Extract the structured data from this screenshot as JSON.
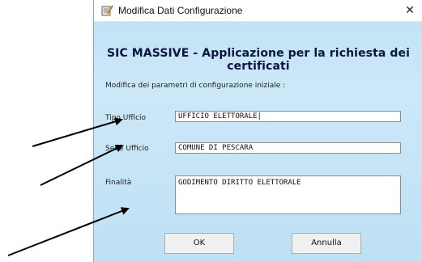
{
  "window": {
    "title": "Modifica Dati Configurazione",
    "close_label": "✕",
    "icon": "notepad-pen-icon"
  },
  "heading": "SIC MASSIVE - Applicazione per la richiesta dei certificati",
  "intro": "Modifica dei parametri di configurazione iniziale :",
  "fields": {
    "tipo_ufficio": {
      "label": "Tipo Ufficio",
      "value": "UFFICIO ELETTORALE|"
    },
    "sede_ufficio": {
      "label": "Sede Ufficio",
      "value": "COMUNE DI PESCARA"
    },
    "finalita": {
      "label": "Finalità",
      "value": "GODIMENTO DIRITTO ELETTORALE"
    }
  },
  "buttons": {
    "ok": "OK",
    "cancel": "Annulla"
  },
  "annotation": {
    "arrow_color": "#000000",
    "arrow_count": 3
  }
}
